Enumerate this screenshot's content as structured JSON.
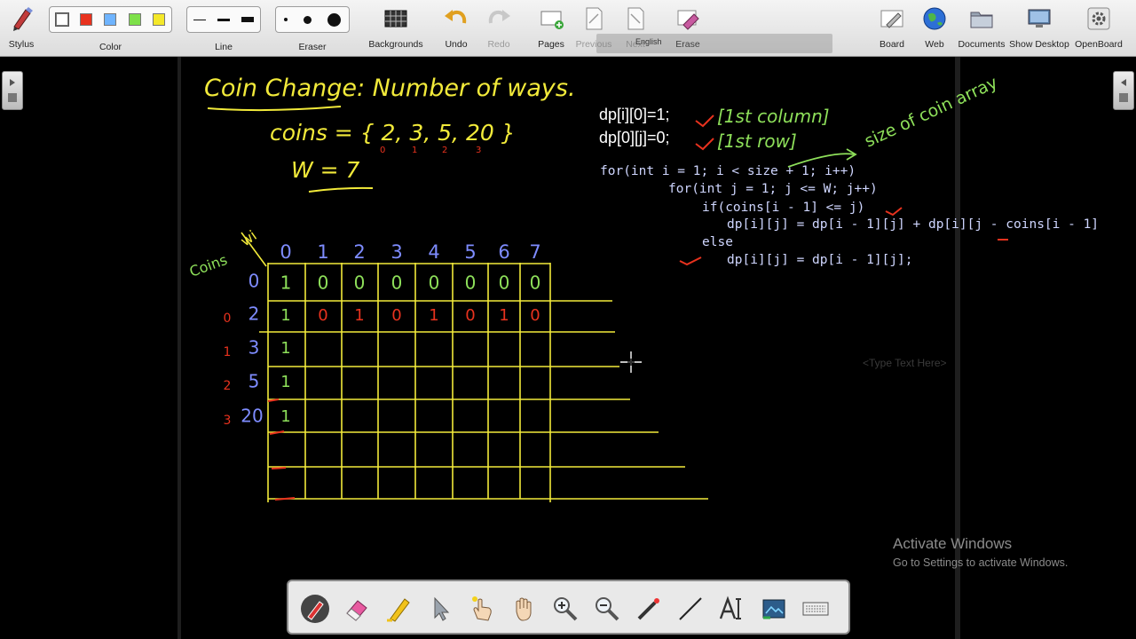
{
  "toolbar": {
    "stylus": "Stylus",
    "color": "Color",
    "line": "Line",
    "eraser": "Eraser",
    "backgrounds": "Backgrounds",
    "undo": "Undo",
    "redo": "Redo",
    "pages": "Pages",
    "previous": "Previous",
    "next": "Next",
    "erase": "Erase",
    "board": "Board",
    "web": "Web",
    "documents": "Documents",
    "show_desktop": "Show Desktop",
    "openboard": "OpenBoard",
    "language": "English",
    "colors": [
      "#ffffff",
      "#e8321e",
      "#6fb4ff",
      "#7ee04a",
      "#f4e82a"
    ],
    "active_color": "#ffffff"
  },
  "board": {
    "title": "Coin Change: Number of ways.",
    "coins_def": "coins = { 2, 3, 5, 20 }",
    "coin_indices": [
      "0",
      "1",
      "2",
      "3"
    ],
    "w_def": "W = 7",
    "corner_top": "wi",
    "corner_side": "Coins",
    "col_headers": [
      "0",
      "1",
      "2",
      "3",
      "4",
      "5",
      "6",
      "7"
    ],
    "row_labels": [
      "0",
      "2",
      "3",
      "5",
      "20"
    ],
    "row_indices": [
      "0",
      "1",
      "2",
      "3"
    ],
    "row0_values": [
      "1",
      "0",
      "0",
      "0",
      "0",
      "0",
      "0",
      "0"
    ],
    "row1_values": [
      "1",
      "0",
      "1",
      "0",
      "1",
      "0",
      "1",
      "0"
    ],
    "col0_values": [
      "1",
      "1",
      "1"
    ],
    "dp_col_rule": "dp[i][0]=1;",
    "dp_row_rule": "dp[0][j]=0;",
    "note_col": "[1st column]",
    "note_row": "[1st row]",
    "note_size": "size of coin array",
    "code_lines": [
      "for(int i = 1; i < size + 1; i++)",
      "for(int j = 1; j <= W; j++)",
      "if(coins[i - 1] <= j)",
      "dp[i][j] = dp[i - 1][j] + dp[i][j - coins[i - 1]",
      "else",
      "dp[i][j] = dp[i - 1][j];"
    ],
    "type_text_placeholder": "<Type Text Here>"
  },
  "watermark": {
    "title": "Activate Windows",
    "subtitle": "Go to Settings to activate Windows."
  },
  "palette": {
    "tools": [
      "pen-tool",
      "eraser-tool",
      "marker-tool",
      "selector-tool",
      "laser-pointer-tool",
      "hand-tool",
      "zoom-in-tool",
      "zoom-out-tool",
      "pointer-tool",
      "line-tool",
      "text-tool",
      "capture-tool",
      "keyboard-tool"
    ]
  }
}
